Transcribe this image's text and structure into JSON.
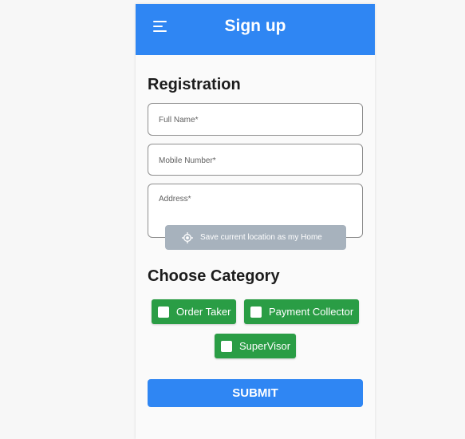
{
  "appbar": {
    "title": "Sign up",
    "menu_icon": "hamburger-menu-icon",
    "color": "#2f86f3"
  },
  "registration": {
    "title": "Registration",
    "full_name_placeholder": "Full Name*",
    "mobile_placeholder": "Mobile Number*",
    "address_placeholder": "Address*",
    "save_location_label": "Save current location as my Home",
    "location_icon": "gps-target-icon"
  },
  "category": {
    "title": "Choose Category",
    "options": [
      {
        "label": "Order Taker",
        "checked": false
      },
      {
        "label": "Payment Collector",
        "checked": false
      },
      {
        "label": "SuperVisor",
        "checked": false
      }
    ],
    "chip_color": "#2a9d45"
  },
  "submit": {
    "label": "SUBMIT"
  }
}
